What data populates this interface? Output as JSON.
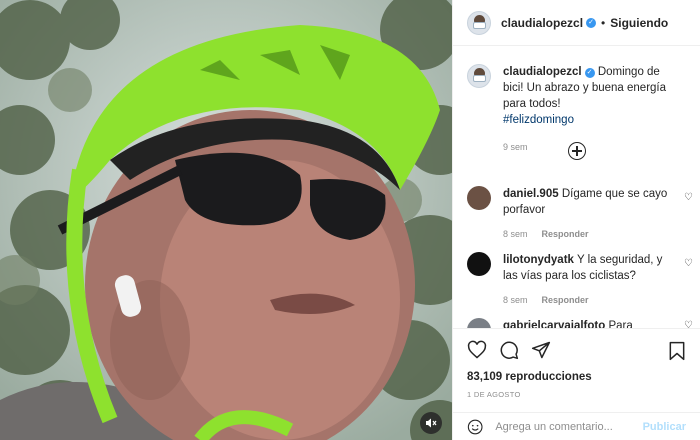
{
  "media": {
    "mute_icon": "muted-speaker-icon",
    "colors": {
      "helmet": "#8ee12e",
      "sky": "#b9c7c8",
      "trees": "#4a5a3f"
    }
  },
  "header": {
    "username": "claudialopezcl",
    "separator": "•",
    "follow_label": "Siguiendo"
  },
  "caption": {
    "username": "claudialopezcl",
    "text": "Domingo de bici! Un abrazo y buena energía para todos!",
    "hashtag": "#felizdomingo",
    "time": "9 sem"
  },
  "load_more_icon": "plus-circle-icon",
  "comments": [
    {
      "username": "daniel.905",
      "text": "Dígame que se cayo porfavor",
      "time": "8 sem",
      "reply": "Responder",
      "avatar_color": "#6b5144"
    },
    {
      "username": "lilotonydyatk",
      "text": "Y la seguridad, y las vías para los ciclistas?",
      "time": "8 sem",
      "reply": "Responder",
      "avatar_color": "#111111"
    },
    {
      "username": "gabrielcarvajalfoto",
      "text": "Para cuando",
      "avatar_color": "#7a7f86"
    }
  ],
  "stats": {
    "views": "83,109 reproducciones",
    "date": "1 DE AGOSTO"
  },
  "add_comment": {
    "placeholder": "Agrega un comentario...",
    "publish": "Publicar"
  }
}
